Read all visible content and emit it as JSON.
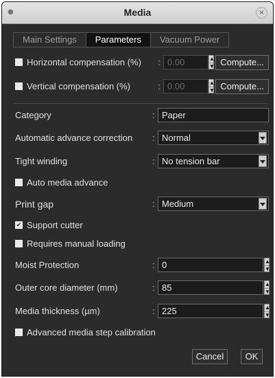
{
  "window": {
    "title": "Media",
    "close_glyph": "×"
  },
  "tabs": [
    {
      "label": "Main Settings",
      "active": false
    },
    {
      "label": "Parameters",
      "active": true
    },
    {
      "label": "Vacuum Power",
      "active": false
    }
  ],
  "compensation": {
    "horizontal": {
      "label": "Horizontal compensation (%)",
      "colon": ":",
      "value": "0.00",
      "checked": false,
      "button": "Compute..."
    },
    "vertical": {
      "label": "Vertical compensation (%)",
      "colon": ":",
      "value": "0.00",
      "checked": false,
      "button": "Compute..."
    }
  },
  "fields": {
    "category": {
      "label": "Category",
      "colon": ":",
      "value": "Paper"
    },
    "auto_advance": {
      "label": "Automatic advance correction",
      "colon": ":",
      "value": "Normal"
    },
    "tight_winding": {
      "label": "Tight winding",
      "colon": ":",
      "value": "No tension bar"
    },
    "auto_media_advance": {
      "label": "Auto media advance",
      "checked": false
    },
    "print_gap": {
      "label": "Print gap",
      "colon": ":",
      "value": "Medium"
    },
    "support_cutter": {
      "label": "Support cutter",
      "checked": true
    },
    "manual_loading": {
      "label": "Requires manual loading",
      "checked": false
    },
    "moist_protection": {
      "label": "Moist Protection",
      "colon": ":",
      "value": "0"
    },
    "outer_core": {
      "label": "Outer core diameter (mm)",
      "colon": ":",
      "value": "85"
    },
    "media_thickness": {
      "label": "Media thickness (µm)",
      "colon": ":",
      "value": "225"
    },
    "step_calibration": {
      "label": "Advanced media step calibration",
      "checked": false
    }
  },
  "buttons": {
    "cancel": "Cancel",
    "ok": "OK"
  },
  "glyphs": {
    "check": "✔",
    "spin_up": "▲",
    "spin_down": "▼"
  }
}
